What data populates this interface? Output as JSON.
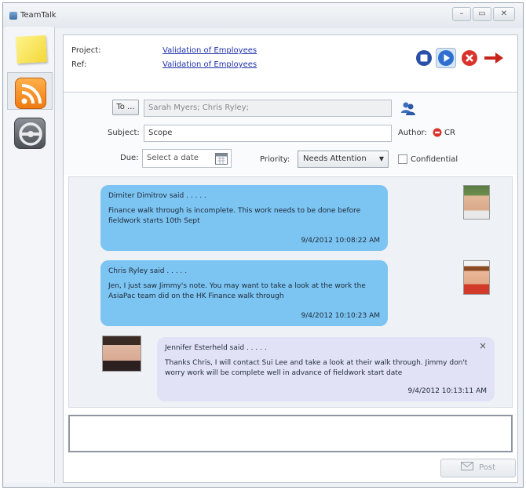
{
  "window": {
    "title": "TeamTalk"
  },
  "header": {
    "project_label": "Project:",
    "project_value": "Validation of Employees",
    "ref_label": "Ref:",
    "ref_value": "Validation of Employees"
  },
  "form": {
    "to_button": "To ...",
    "to_value": "Sarah Myers; Chris Ryley;",
    "subject_label": "Subject:",
    "subject_value": "Scope",
    "author_label": "Author:",
    "author_value": "CR",
    "due_label": "Due:",
    "due_placeholder": "Select a date",
    "priority_label": "Priority:",
    "priority_value": "Needs Attention",
    "confidential_label": "Confidential"
  },
  "messages": [
    {
      "author": "Dimiter Dimitrov said . . . . .",
      "body": "Finance walk through is incomplete. This work needs to be done before fieldwork starts 10th Sept",
      "time": "9/4/2012 10:08:22 AM"
    },
    {
      "author": "Chris Ryley said . . . . .",
      "body": "Jen, I just saw Jimmy's note. You may want to take a look at the work the AsiaPac team did on the HK Finance walk through",
      "time": "9/4/2012 10:10:23 AM"
    },
    {
      "author": "Jennifer Esterheld said . . . . .",
      "body": "Thanks Chris, I will contact Sui Lee and take a look at their walk through. Jimmy don't worry work will be complete well in advance of fieldwork start date",
      "time": "9/4/2012 10:13:11 AM"
    }
  ],
  "post_button": "Post",
  "colors": {
    "bubble_blue": "#7cc4f2",
    "bubble_lavender": "#e2e2f7",
    "link": "#2233aa",
    "stop_red": "#d9332b"
  },
  "icons": [
    "note-icon",
    "rss-icon",
    "steering-wheel-icon",
    "stop-icon",
    "play-icon",
    "cancel-icon",
    "arrow-right-icon",
    "address-book-icon",
    "calendar-icon",
    "dropdown-arrow-icon",
    "close-icon",
    "envelope-icon"
  ]
}
